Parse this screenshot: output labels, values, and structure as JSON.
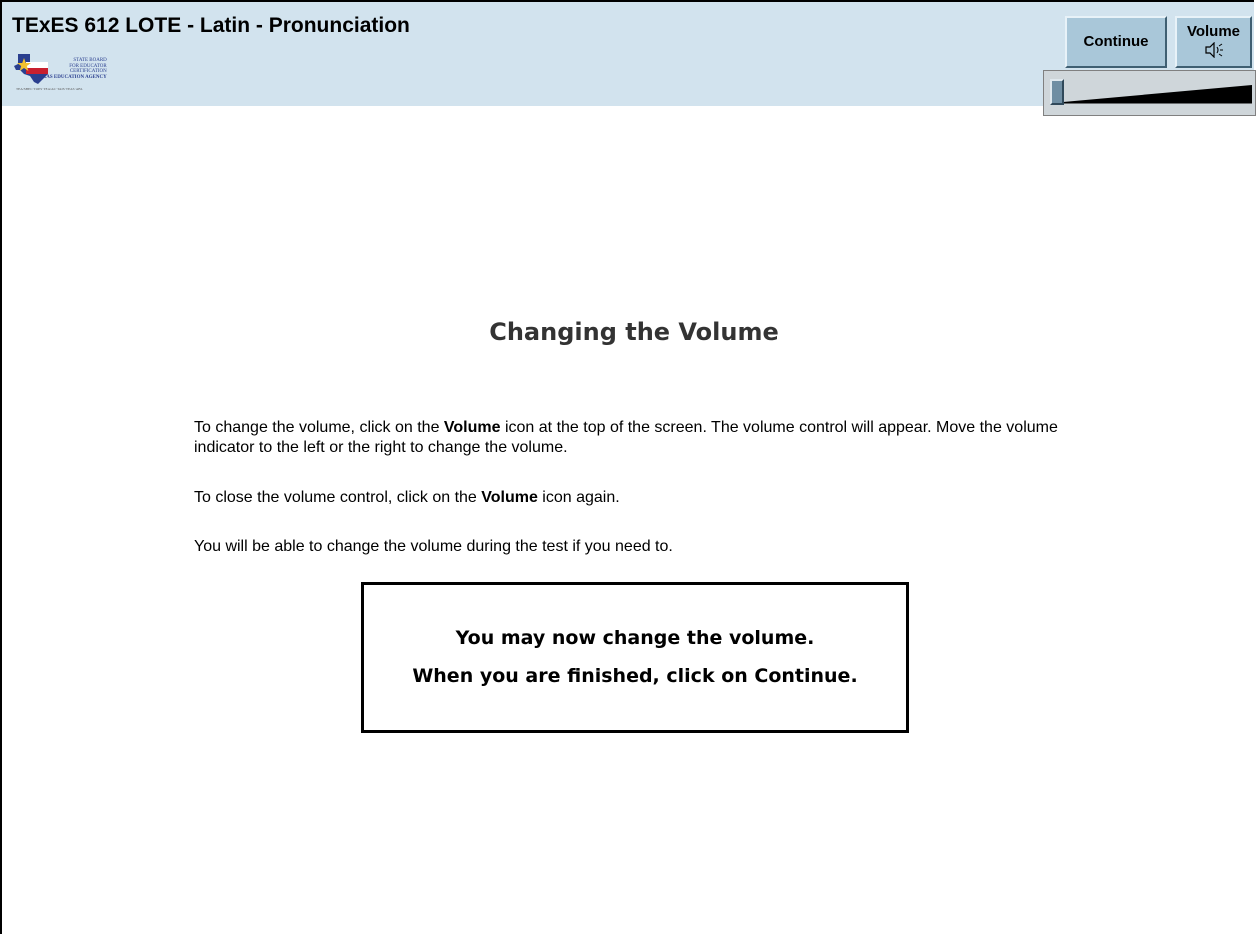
{
  "header": {
    "title": "TExES 612 LOTE - Latin - Pronunciation",
    "logo": {
      "lines": [
        "STATE BOARD",
        "FOR EDUCATOR",
        "CERTIFICATION",
        "TEXAS EDUCATION AGENCY"
      ],
      "subline": "TEA/SBEC·TOPS·TEA/AC·TAIS·TEAS·ABL",
      "accent_color": "#2a3f8f",
      "flag_red": "#c8202f",
      "star_color": "#f2c230"
    },
    "continue_label": "Continue",
    "volume_label": "Volume",
    "volume_icon": "speaker-icon"
  },
  "volume_control": {
    "level": 0.0
  },
  "main": {
    "title": "Changing the Volume",
    "paragraph1": {
      "before": "To change the volume, click on the ",
      "bold": "Volume",
      "after": " icon at the top of the screen. The volume control will appear. Move the volume indicator to the left or the right to change the volume."
    },
    "paragraph2": {
      "before": "To close the volume control, click on the ",
      "bold": "Volume",
      "after": " icon again."
    },
    "paragraph3": "You will be able to change the volume during the test if you need to.",
    "notice": {
      "line1": "You may now change the volume.",
      "line2": "When you are finished, click on Continue."
    }
  },
  "colors": {
    "header_bg": "#d2e3ee",
    "button_bg": "#a9c7d9",
    "slider_panel_bg": "#cfd6da",
    "slider_thumb": "#6f8ea3"
  }
}
